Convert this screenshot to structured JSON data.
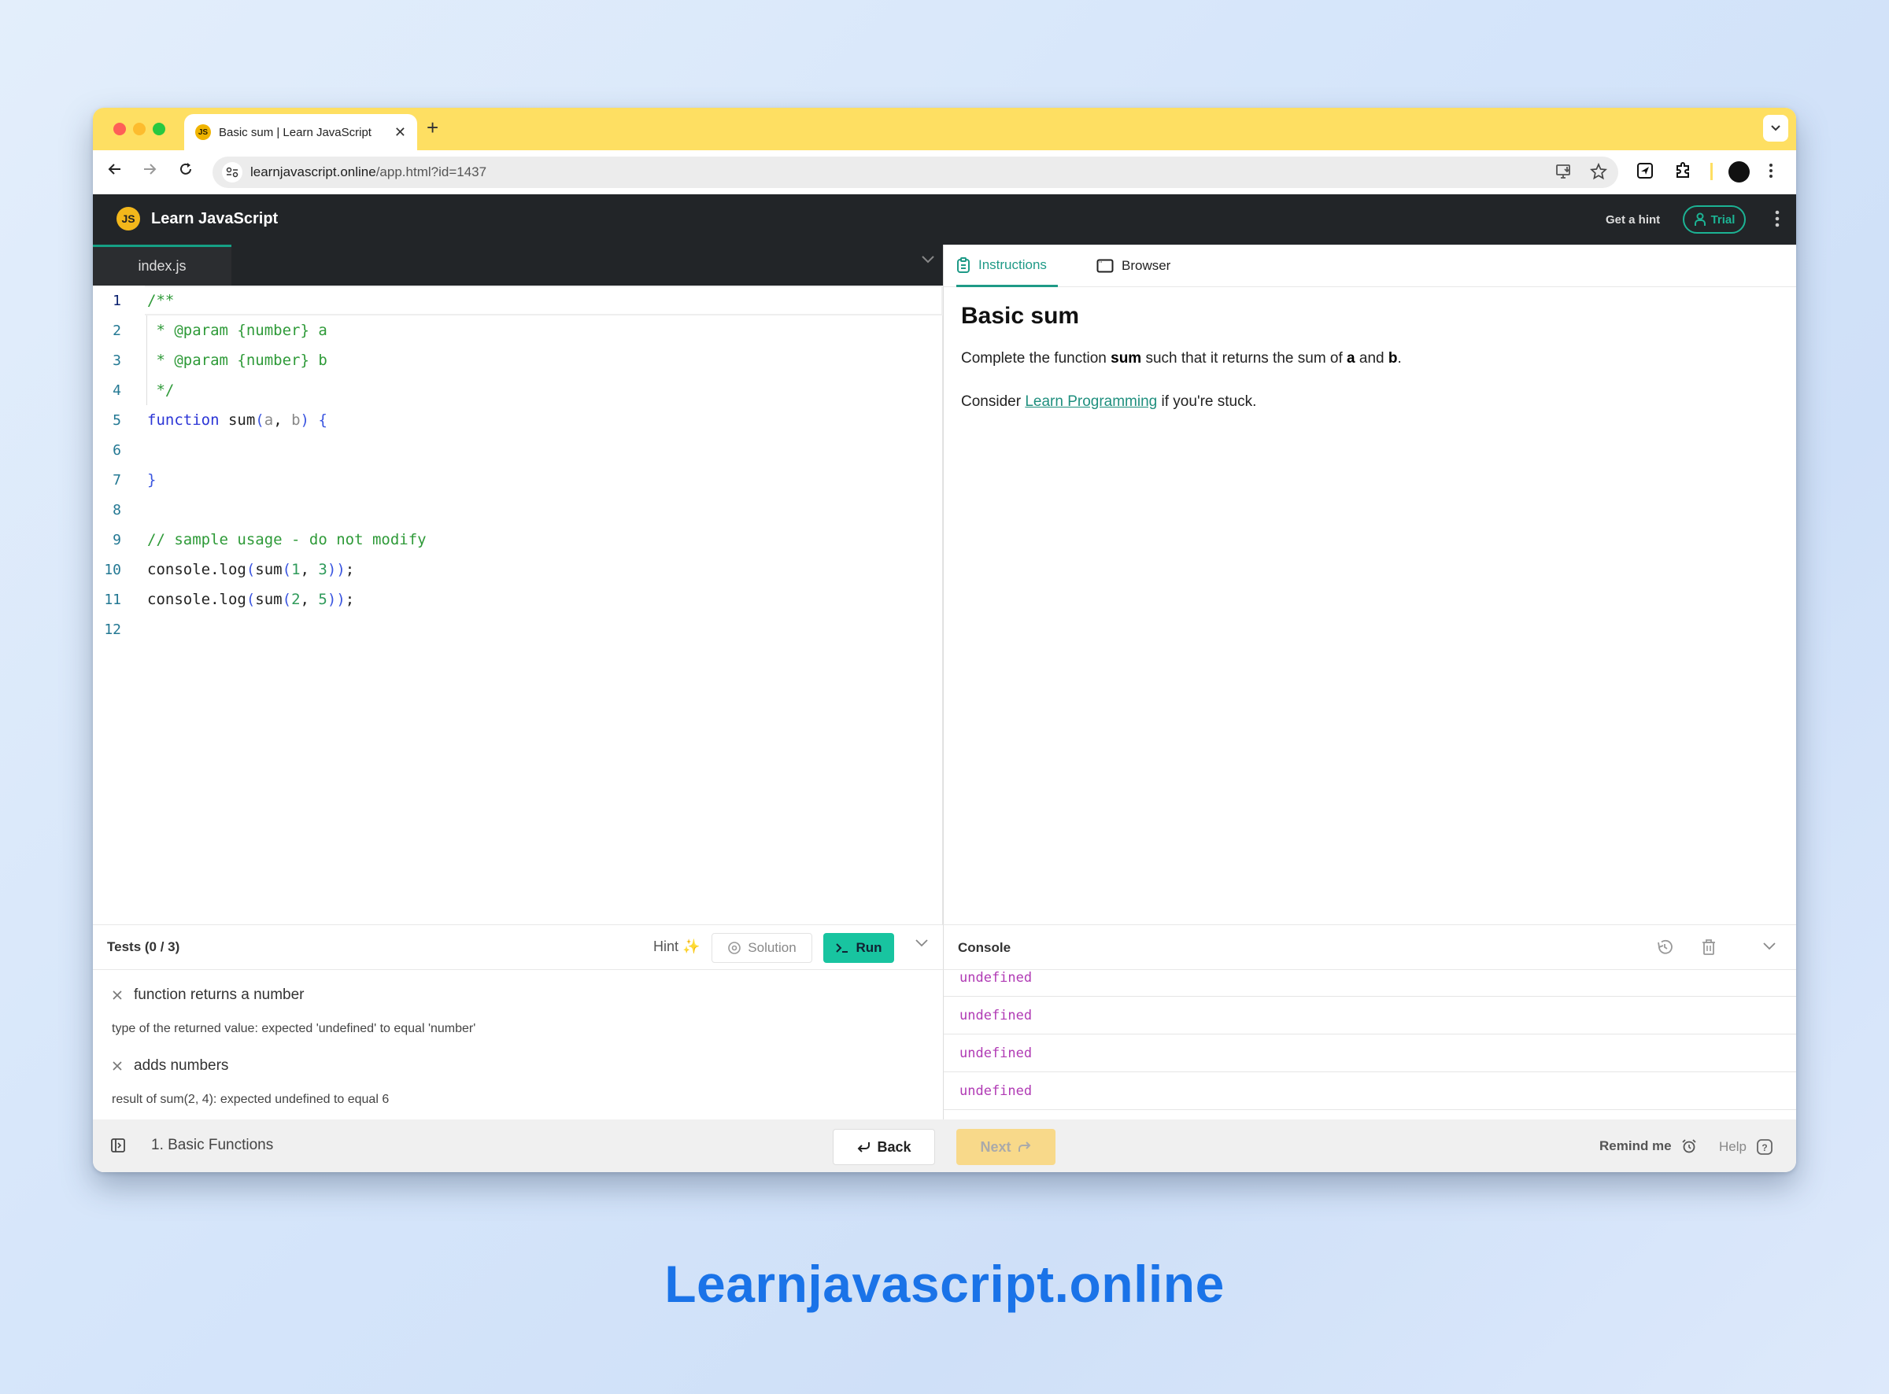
{
  "browser": {
    "tab_title": "Basic sum | Learn JavaScript",
    "tab_favicon": "JS",
    "url_domain": "learnjavascript.online",
    "url_path": "/app.html?id=1437"
  },
  "app": {
    "logo": "JS",
    "title": "Learn JavaScript",
    "get_hint": "Get a hint",
    "trial": "Trial"
  },
  "editor": {
    "file_tab": "index.js",
    "line_numbers": [
      "1",
      "2",
      "3",
      "4",
      "5",
      "6",
      "7",
      "8",
      "9",
      "10",
      "11",
      "12"
    ],
    "lines": [
      "/**",
      " * @param {number} a",
      " * @param {number} b",
      " */",
      "function sum(a, b) {",
      "",
      "}",
      "",
      "// sample usage - do not modify",
      "console.log(sum(1, 3));",
      "console.log(sum(2, 5));",
      ""
    ]
  },
  "right_panel": {
    "tabs": [
      {
        "label": "Instructions",
        "icon": "clipboard-icon",
        "active": true
      },
      {
        "label": "Browser",
        "icon": "browser-window-icon",
        "active": false
      }
    ],
    "title": "Basic sum",
    "p1": {
      "t1": "Complete the function ",
      "b1": "sum",
      "t2": " such that it returns the sum of ",
      "b2": "a",
      "t3": " and ",
      "b3": "b",
      "t4": "."
    },
    "p2": {
      "t1": "Consider ",
      "link": "Learn Programming",
      "t2": " if you're stuck."
    }
  },
  "tests": {
    "title": "Tests (0 / 3)",
    "hint_label": "Hint",
    "hint_emoji": "✨",
    "solution_label": "Solution",
    "run_label": "Run",
    "items": [
      {
        "name": "function returns a number",
        "error": "type of the returned value: expected 'undefined' to equal 'number'"
      },
      {
        "name": "adds numbers",
        "error": "result of sum(2, 4): expected undefined to equal 6"
      }
    ]
  },
  "console": {
    "title": "Console",
    "rows": [
      "undefined",
      "undefined",
      "undefined",
      "undefined"
    ]
  },
  "footer": {
    "chapter": "1. Basic Functions",
    "back": "Back",
    "next": "Next",
    "remind": "Remind me",
    "help": "Help"
  },
  "caption": "Learnjavascript.online",
  "colors": {
    "tab_strip": "#fedf62",
    "accent": "#1f9a87",
    "run_button": "#18c4a0",
    "next_button": "#f8d98a",
    "console_value": "#b03ab4",
    "caption": "#1a73e8"
  }
}
